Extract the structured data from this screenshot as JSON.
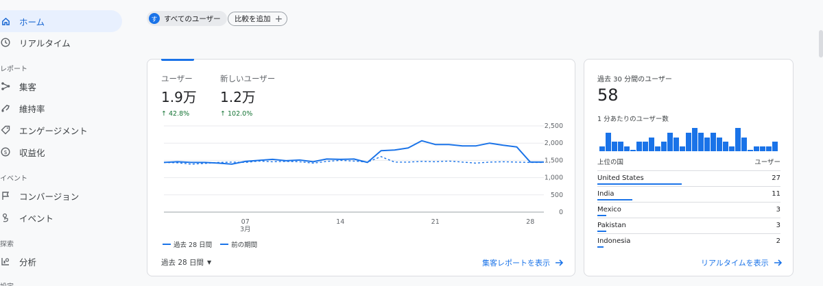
{
  "sidebar": {
    "home": "ホーム",
    "realtime": "リアルタイム",
    "section_reports": "レポート",
    "acquisition": "集客",
    "retention": "維持率",
    "engagement": "エンゲージメント",
    "monetization": "収益化",
    "section_events": "イベント",
    "conversions": "コンバージョン",
    "events": "イベント",
    "section_explore": "探索",
    "analysis": "分析",
    "section_configure": "設定"
  },
  "top_bar": {
    "avatar_letter": "す",
    "user_segment": "すべてのユーザー",
    "compare_label": "比較を追加"
  },
  "main_card": {
    "metrics": [
      {
        "label": "ユーザー",
        "value": "1.9万",
        "change": "42.8%"
      },
      {
        "label": "新しいユーザー",
        "value": "1.2万",
        "change": "102.0%"
      }
    ],
    "legend": {
      "current": "過去 28 日間",
      "previous": "前の期間"
    },
    "date_range": "過去 28 日間",
    "link": "集客レポートを表示"
  },
  "chart_data": {
    "type": "line",
    "x": [
      1,
      2,
      3,
      4,
      5,
      6,
      7,
      8,
      9,
      10,
      11,
      12,
      13,
      14,
      15,
      16,
      17,
      18,
      19,
      20,
      21,
      22,
      23,
      24,
      25,
      26,
      27,
      28,
      29
    ],
    "x_tick_labels": [
      {
        "day": 7,
        "label": "07",
        "sublabel": "3月"
      },
      {
        "day": 14,
        "label": "14"
      },
      {
        "day": 21,
        "label": "21"
      },
      {
        "day": 28,
        "label": "28"
      }
    ],
    "y_ticks": [
      "2,500",
      "2,000",
      "1,500",
      "1,000",
      "500",
      "0"
    ],
    "ylim": [
      0,
      2500
    ],
    "y_tick_values": [
      2500,
      2000,
      1500,
      1000,
      500,
      0
    ],
    "series": [
      {
        "name": "過去 28 日間",
        "style": "solid",
        "color": "#1a73e8",
        "values": [
          1440,
          1460,
          1440,
          1440,
          1420,
          1390,
          1470,
          1500,
          1530,
          1490,
          1510,
          1460,
          1540,
          1530,
          1540,
          1440,
          1780,
          1800,
          1860,
          2070,
          1960,
          1960,
          1920,
          1920,
          2000,
          1940,
          1890,
          1450,
          1450
        ]
      },
      {
        "name": "前の期間",
        "style": "dashed",
        "color": "#1a73e8",
        "values": [
          1440,
          1430,
          1390,
          1410,
          1440,
          1450,
          1440,
          1480,
          1460,
          1470,
          1460,
          1420,
          1470,
          1500,
          1480,
          1450,
          1610,
          1450,
          1450,
          1470,
          1460,
          1480,
          1450,
          1420,
          1450,
          1460,
          1450,
          1440,
          1440
        ]
      }
    ]
  },
  "realtime_card": {
    "title": "過去 30 分間のユーザー",
    "value": "58",
    "subtitle": "1 分あたりのユーザー数",
    "per_minute": [
      1,
      4,
      2,
      2,
      1,
      0,
      2,
      2,
      3,
      1,
      2,
      4,
      3,
      1,
      4,
      5,
      4,
      3,
      4,
      3,
      2,
      1,
      5,
      3,
      0,
      1,
      1,
      1,
      2
    ],
    "table_head_left": "上位の国",
    "table_head_right": "ユーザー",
    "countries": [
      {
        "name": "United States",
        "users": "27",
        "share": 0.46
      },
      {
        "name": "India",
        "users": "11",
        "share": 0.19
      },
      {
        "name": "Mexico",
        "users": "3",
        "share": 0.05
      },
      {
        "name": "Pakistan",
        "users": "3",
        "share": 0.05
      },
      {
        "name": "Indonesia",
        "users": "2",
        "share": 0.035
      }
    ],
    "link": "リアルタイムを表示"
  },
  "colors": {
    "accent": "#1a73e8",
    "positive": "#137333"
  }
}
